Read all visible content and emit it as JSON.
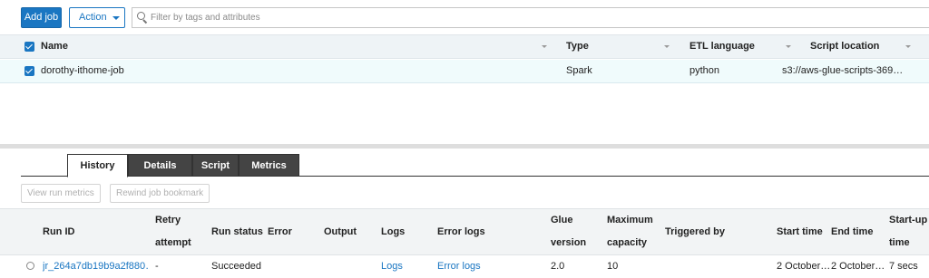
{
  "toolbar": {
    "add_job_label": "Add job",
    "action_label": "Action",
    "filter_placeholder": "Filter by tags and attributes"
  },
  "jobs_table": {
    "columns": [
      "Name",
      "Type",
      "ETL language",
      "Script location"
    ],
    "rows": [
      {
        "name": "dorothy-ithome-job",
        "type": "Spark",
        "etl_language": "python",
        "script_location": "s3://aws-glue-scripts-369…"
      }
    ]
  },
  "tabs": [
    "History",
    "Details",
    "Script",
    "Metrics"
  ],
  "active_tab": "History",
  "history": {
    "view_run_metrics_label": "View run metrics",
    "rewind_bookmark_label": "Rewind job bookmark",
    "columns": {
      "run_id": "Run ID",
      "retry_attempt": [
        "Retry",
        "attempt"
      ],
      "run_status": "Run status",
      "error": "Error",
      "output": "Output",
      "logs": "Logs",
      "error_logs": "Error logs",
      "glue_version": [
        "Glue",
        "version"
      ],
      "maximum_capacity": [
        "Maximum",
        "capacity"
      ],
      "triggered_by": "Triggered by",
      "start_time": "Start time",
      "end_time": "End time",
      "startup_time": [
        "Start-up",
        "time"
      ]
    },
    "rows": [
      {
        "run_id": "jr_264a7db19b9a2f880…",
        "retry_attempt": "-",
        "run_status": "Succeeded",
        "error": "",
        "output": "",
        "logs": "Logs",
        "error_logs": "Error logs",
        "glue_version": "2.0",
        "maximum_capacity": "10",
        "triggered_by": "",
        "start_time": "2 October…",
        "end_time": "2 October…",
        "startup_time": "7 secs"
      }
    ]
  },
  "colors": {
    "accent": "#1a76c2",
    "selected_row": "#f0fbfc",
    "header_bg": "#eef3f6",
    "inactive_tab": "#444444"
  }
}
